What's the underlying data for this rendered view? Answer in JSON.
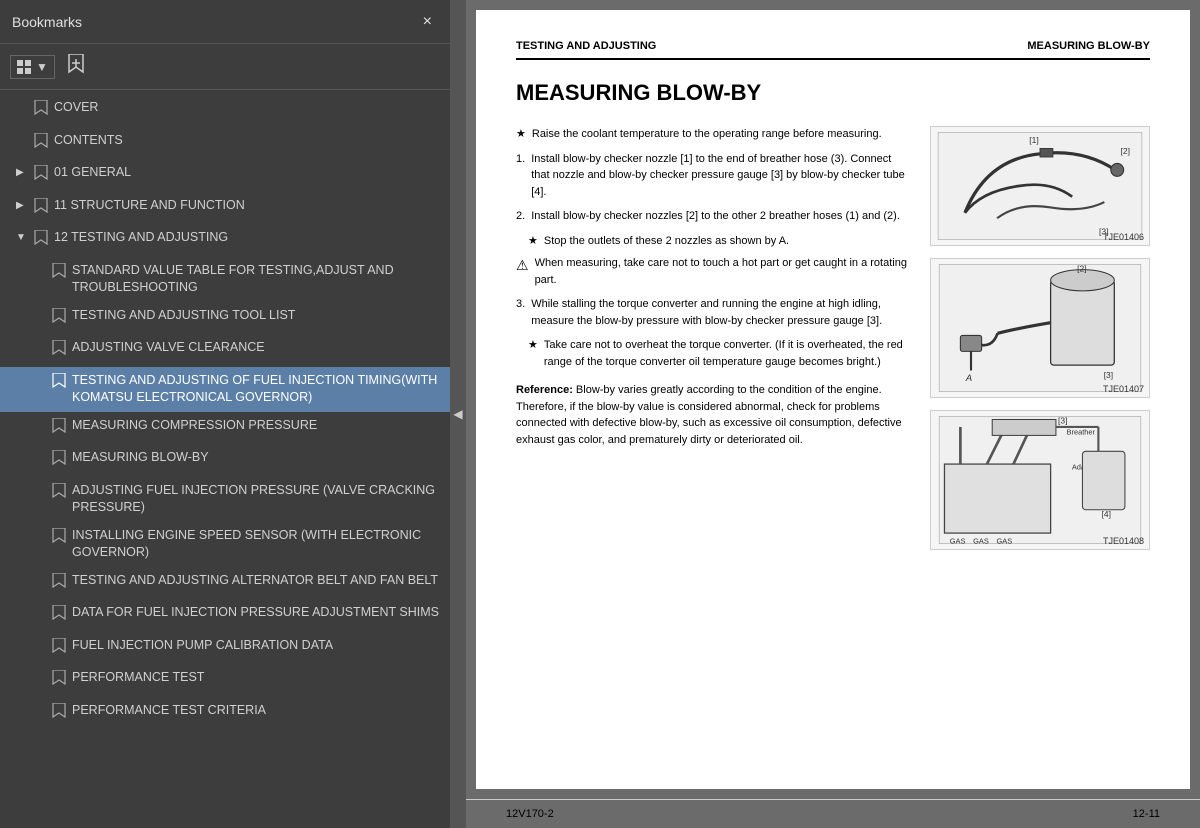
{
  "bookmarks": {
    "title": "Bookmarks",
    "close_label": "×",
    "items": [
      {
        "id": "cover",
        "label": "COVER",
        "level": 1,
        "expanded": false,
        "active": false,
        "has_children": false
      },
      {
        "id": "contents",
        "label": "CONTENTS",
        "level": 1,
        "expanded": false,
        "active": false,
        "has_children": false
      },
      {
        "id": "general",
        "label": "01 GENERAL",
        "level": 1,
        "expanded": false,
        "active": false,
        "has_children": true
      },
      {
        "id": "structure",
        "label": "11 STRUCTURE AND FUNCTION",
        "level": 1,
        "expanded": false,
        "active": false,
        "has_children": true
      },
      {
        "id": "testing",
        "label": "12 TESTING AND ADJUSTING",
        "level": 1,
        "expanded": true,
        "active": false,
        "has_children": true
      },
      {
        "id": "std_val",
        "label": "STANDARD VALUE TABLE FOR TESTING,ADJUST AND TROUBLESHOOTING",
        "level": 2,
        "active": false
      },
      {
        "id": "tool_list",
        "label": "TESTING AND ADJUSTING TOOL LIST",
        "level": 2,
        "active": false
      },
      {
        "id": "valve_clear",
        "label": "ADJUSTING VALVE CLEARANCE",
        "level": 2,
        "active": false
      },
      {
        "id": "fuel_inject_timing",
        "label": "TESTING AND ADJUSTING OF FUEL INJECTION TIMING(WITH KOMATSU ELECTRONICAL GOVERNOR)",
        "level": 2,
        "active": true
      },
      {
        "id": "comp_pressure",
        "label": "MEASURING COMPRESSION PRESSURE",
        "level": 2,
        "active": false
      },
      {
        "id": "blow_by",
        "label": "MEASURING BLOW-BY",
        "level": 2,
        "active": false
      },
      {
        "id": "adj_fuel",
        "label": "ADJUSTING FUEL INJECTION PRESSURE (VALVE CRACKING PRESSURE)",
        "level": 2,
        "active": false
      },
      {
        "id": "install_speed",
        "label": "INSTALLING ENGINE SPEED SENSOR (WITH ELECTRONIC GOVERNOR)",
        "level": 2,
        "active": false
      },
      {
        "id": "alt_belt",
        "label": "TESTING AND ADJUSTING ALTERNATOR BELT AND FAN BELT",
        "level": 2,
        "active": false
      },
      {
        "id": "data_fuel",
        "label": "DATA FOR FUEL INJECTION PRESSURE ADJUSTMENT SHIMS",
        "level": 2,
        "active": false
      },
      {
        "id": "fuel_pump",
        "label": "FUEL INJECTION PUMP CALIBRATION DATA",
        "level": 2,
        "active": false
      },
      {
        "id": "perf_test",
        "label": "PERFORMANCE TEST",
        "level": 2,
        "active": false
      },
      {
        "id": "perf_criteria",
        "label": "PERFORMANCE TEST CRITERIA",
        "level": 2,
        "active": false
      }
    ]
  },
  "document": {
    "header_left": "TESTING AND ADJUSTING",
    "header_right": "MEASURING BLOW-BY",
    "title": "MEASURING BLOW-BY",
    "star_intro": "Raise the coolant temperature to the operating range before measuring.",
    "steps": [
      {
        "num": "1.",
        "text": "Install blow-by checker nozzle [1] to the end of breather hose (3).  Connect that nozzle and blow-by checker pressure gauge [3] by blow-by checker tube [4]."
      },
      {
        "num": "2.",
        "text": "Install blow-by checker nozzles [2] to the other 2 breather hoses (1) and (2)."
      },
      {
        "num": "2_sub",
        "star": true,
        "text": "Stop the outlets of these 2 nozzles as shown by A."
      },
      {
        "num": "warning",
        "text": "When measuring, take care not to touch a hot part or get caught in a rotating part."
      },
      {
        "num": "3.",
        "text": "While stalling the torque converter and running the engine at high idling, measure the blow-by pressure with blow-by checker pressure gauge [3]."
      },
      {
        "num": "3_sub",
        "star": true,
        "text": "Take care not to overheat the torque converter. (If it is overheated, the red range of the torque converter oil temperature gauge becomes bright.)"
      }
    ],
    "reference": {
      "title": "Reference:",
      "text": "Blow-by varies greatly according to the condition of the engine. Therefore, if the blow-by value is considered abnormal, check for problems connected with defective blow-by, such as excessive oil consumption, defective exhaust gas color, and prematurely dirty or deteriorated oil."
    },
    "footer_left": "12V170-2",
    "footer_right": "12-11",
    "images": [
      {
        "id": "TJE01406",
        "label": "TJE01406"
      },
      {
        "id": "TJE01407",
        "label": "TJE01407"
      },
      {
        "id": "TJE01408",
        "label": "TJE01408"
      }
    ]
  }
}
